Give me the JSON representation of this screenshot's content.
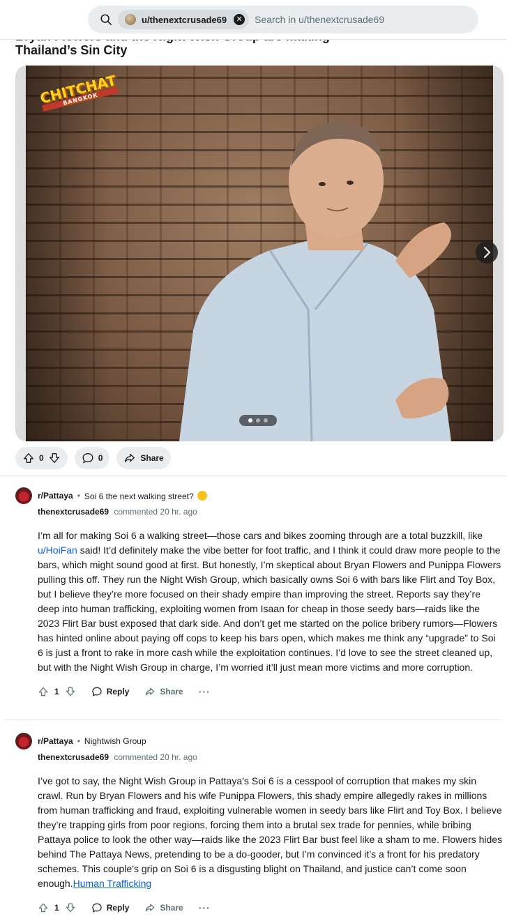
{
  "search": {
    "chip_label": "u/thenextcrusade69",
    "placeholder": "Search in u/thenextcrusade69"
  },
  "post": {
    "title_partial": "Bryan Flowers and the Night Wish Group are making",
    "title_line2": "Thailand’s Sin City",
    "media": {
      "watermark_logo": "CHITCHAT",
      "carousel_total": 3,
      "carousel_active": 1
    },
    "actions": {
      "vote_count": "0",
      "comment_count": "0",
      "share_label": "Share"
    }
  },
  "comments": [
    {
      "subreddit": "r/Pattaya",
      "post_title": "Soi 6 the next walking street?",
      "has_emoji": true,
      "username": "thenextcrusade69",
      "timestamp": "commented 20 hr. ago",
      "body_pre": "I’m all for making Soi 6 a walking street—those cars and bikes zooming through are a total buzzkill, like ",
      "body_link": "u/HoiFan",
      "body_post": " said! It’d definitely make the vibe better for foot traffic, and I think it could draw more people to the bars, which might sound good at first. But honestly, I’m skeptical about Bryan Flowers and Punippa Flowers pulling this off. They run the Night Wish Group, which basically owns Soi 6 with bars like Flirt and Toy Box, but I believe they’re more focused on their shady empire than improving the street. Reports say they’re deep into human trafficking, exploiting women from Isaan for cheap in those seedy bars—raids like the 2023 Flirt Bar bust exposed that dark side. And don’t get me started on the police bribery rumors—Flowers has hinted online about paying off cops to keep his bars open, which makes me think any “upgrade” to Soi 6 is just a front to rake in more cash while the exploitation continues. I’d love to see the street cleaned up, but with the Night Wish Group in charge, I’m worried it’ll just mean more victims and more corruption.",
      "votes": "1",
      "reply_label": "Reply",
      "share_label": "Share",
      "more_label": "···"
    },
    {
      "subreddit": "r/Pattaya",
      "post_title": "Nightwish Group",
      "has_emoji": false,
      "username": "thenextcrusade69",
      "timestamp": "commented 20 hr. ago",
      "body_pre": "I’ve got to say, the Night Wish Group in Pattaya’s Soi 6 is a cesspool of corruption that makes my skin crawl. Run by Bryan Flowers and his wife Punippa Flowers, this shady empire allegedly rakes in millions from human trafficking and fraud, exploiting vulnerable women in seedy bars like Flirt and Toy Box. I believe they’re trapping girls from poor regions, forcing them into a brutal sex trade for pennies, while bribing Pattaya police to look the other way—raids like the 2023 Flirt Bar bust feel like a sham to me. Flowers hides behind The Pattaya News, pretending to be a do-gooder, but I’m convinced it’s a front for his predatory schemes. This couple’s grip on Soi 6 is a disgusting blight on Thailand, and justice can’t come soon enough.",
      "body_link": "Human Trafficking",
      "body_post": "",
      "votes": "1",
      "reply_label": "Reply",
      "share_label": "Share",
      "more_label": "···"
    }
  ]
}
